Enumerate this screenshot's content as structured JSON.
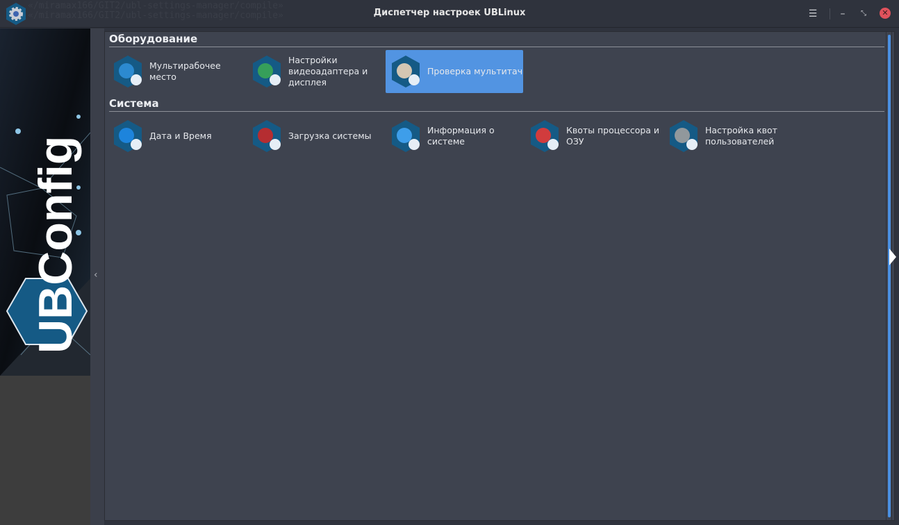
{
  "window": {
    "title": "Диспетчер настроек UBLinux",
    "background_text": [
      "«/miramax166/GIT2/ubl-settings-manager/compile»",
      "«/miramax166/GIT2/ubl-settings-manager/compile»"
    ]
  },
  "titlebar": {
    "menu_icon": "hamburger-icon",
    "minimize_icon": "minimize-icon",
    "maximize_icon": "restore-icon",
    "close_icon": "close-icon"
  },
  "sidebar": {
    "logo_text": "UBConfig"
  },
  "sections": [
    {
      "title": "Оборудование",
      "items": [
        {
          "label": "Мультирабочее место",
          "icon": "multiseat-icon",
          "color": "#2f8fd8",
          "selected": false
        },
        {
          "label": "Настройки видеоадаптера и дисплея",
          "icon": "video-adapter-icon",
          "color": "#3aa655",
          "selected": false
        },
        {
          "label": "Проверка мультитач",
          "icon": "multitouch-hand-icon",
          "color": "#e8d2b8",
          "selected": true
        }
      ]
    },
    {
      "title": "Система",
      "items": [
        {
          "label": "Дата и Время",
          "icon": "clock-calendar-icon",
          "color": "#1e88e5",
          "selected": false
        },
        {
          "label": "Загрузка системы",
          "icon": "boot-icon",
          "color": "#c62828",
          "selected": false
        },
        {
          "label": "Информация о системе",
          "icon": "lightbulb-icon",
          "color": "#42a5f5",
          "selected": false
        },
        {
          "label": "Квоты процессора и ОЗУ",
          "icon": "gauge-icon",
          "color": "#e53935",
          "selected": false
        },
        {
          "label": "Настройка квот пользователей",
          "icon": "disk-quota-icon",
          "color": "#9e9e9e",
          "selected": false
        }
      ]
    }
  ],
  "colors": {
    "accent": "#5294e2",
    "hex": "#155a85",
    "panel": "#3e434f",
    "title": "#2f333d"
  }
}
